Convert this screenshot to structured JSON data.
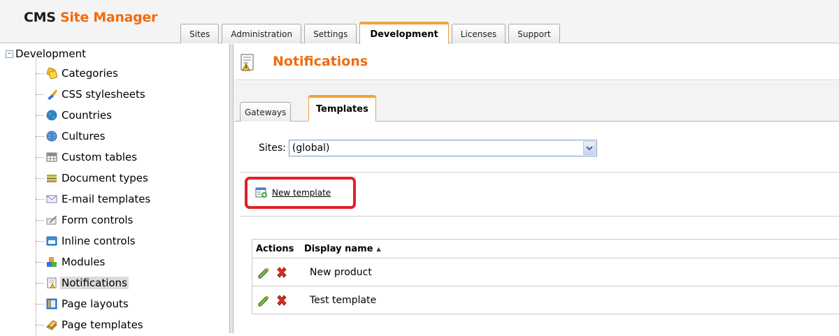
{
  "app": {
    "logo_cms": "CMS",
    "logo_rest": "Site Manager"
  },
  "header_tabs": [
    {
      "label": "Sites",
      "active": false
    },
    {
      "label": "Administration",
      "active": false
    },
    {
      "label": "Settings",
      "active": false
    },
    {
      "label": "Development",
      "active": true
    },
    {
      "label": "Licenses",
      "active": false
    },
    {
      "label": "Support",
      "active": false
    }
  ],
  "sidebar": {
    "root_label": "Development",
    "expander": "−",
    "items": [
      {
        "label": "Categories",
        "icon": "categories-icon"
      },
      {
        "label": "CSS stylesheets",
        "icon": "css-stylesheets-icon"
      },
      {
        "label": "Countries",
        "icon": "countries-icon"
      },
      {
        "label": "Cultures",
        "icon": "cultures-icon"
      },
      {
        "label": "Custom tables",
        "icon": "custom-tables-icon"
      },
      {
        "label": "Document types",
        "icon": "document-types-icon"
      },
      {
        "label": "E-mail templates",
        "icon": "email-templates-icon"
      },
      {
        "label": "Form controls",
        "icon": "form-controls-icon"
      },
      {
        "label": "Inline controls",
        "icon": "inline-controls-icon"
      },
      {
        "label": "Modules",
        "icon": "modules-icon"
      },
      {
        "label": "Notifications",
        "icon": "notifications-icon",
        "selected": true
      },
      {
        "label": "Page layouts",
        "icon": "page-layouts-icon"
      },
      {
        "label": "Page templates",
        "icon": "page-templates-icon"
      }
    ]
  },
  "main": {
    "title": "Notifications",
    "subtabs": [
      {
        "label": "Gateways",
        "active": false
      },
      {
        "label": "Templates",
        "active": true
      }
    ],
    "sites_label": "Sites:",
    "sites_value": "(global)",
    "new_template_label": "New template",
    "grid": {
      "col_actions": "Actions",
      "col_name": "Display name",
      "sort_indicator": "▲",
      "rows": [
        {
          "name": "New product"
        },
        {
          "name": "Test template"
        }
      ]
    }
  },
  "colors": {
    "brand_orange": "#f26b0e",
    "tab_active_top": "#f5a23a",
    "highlight_red": "#e41e26"
  }
}
